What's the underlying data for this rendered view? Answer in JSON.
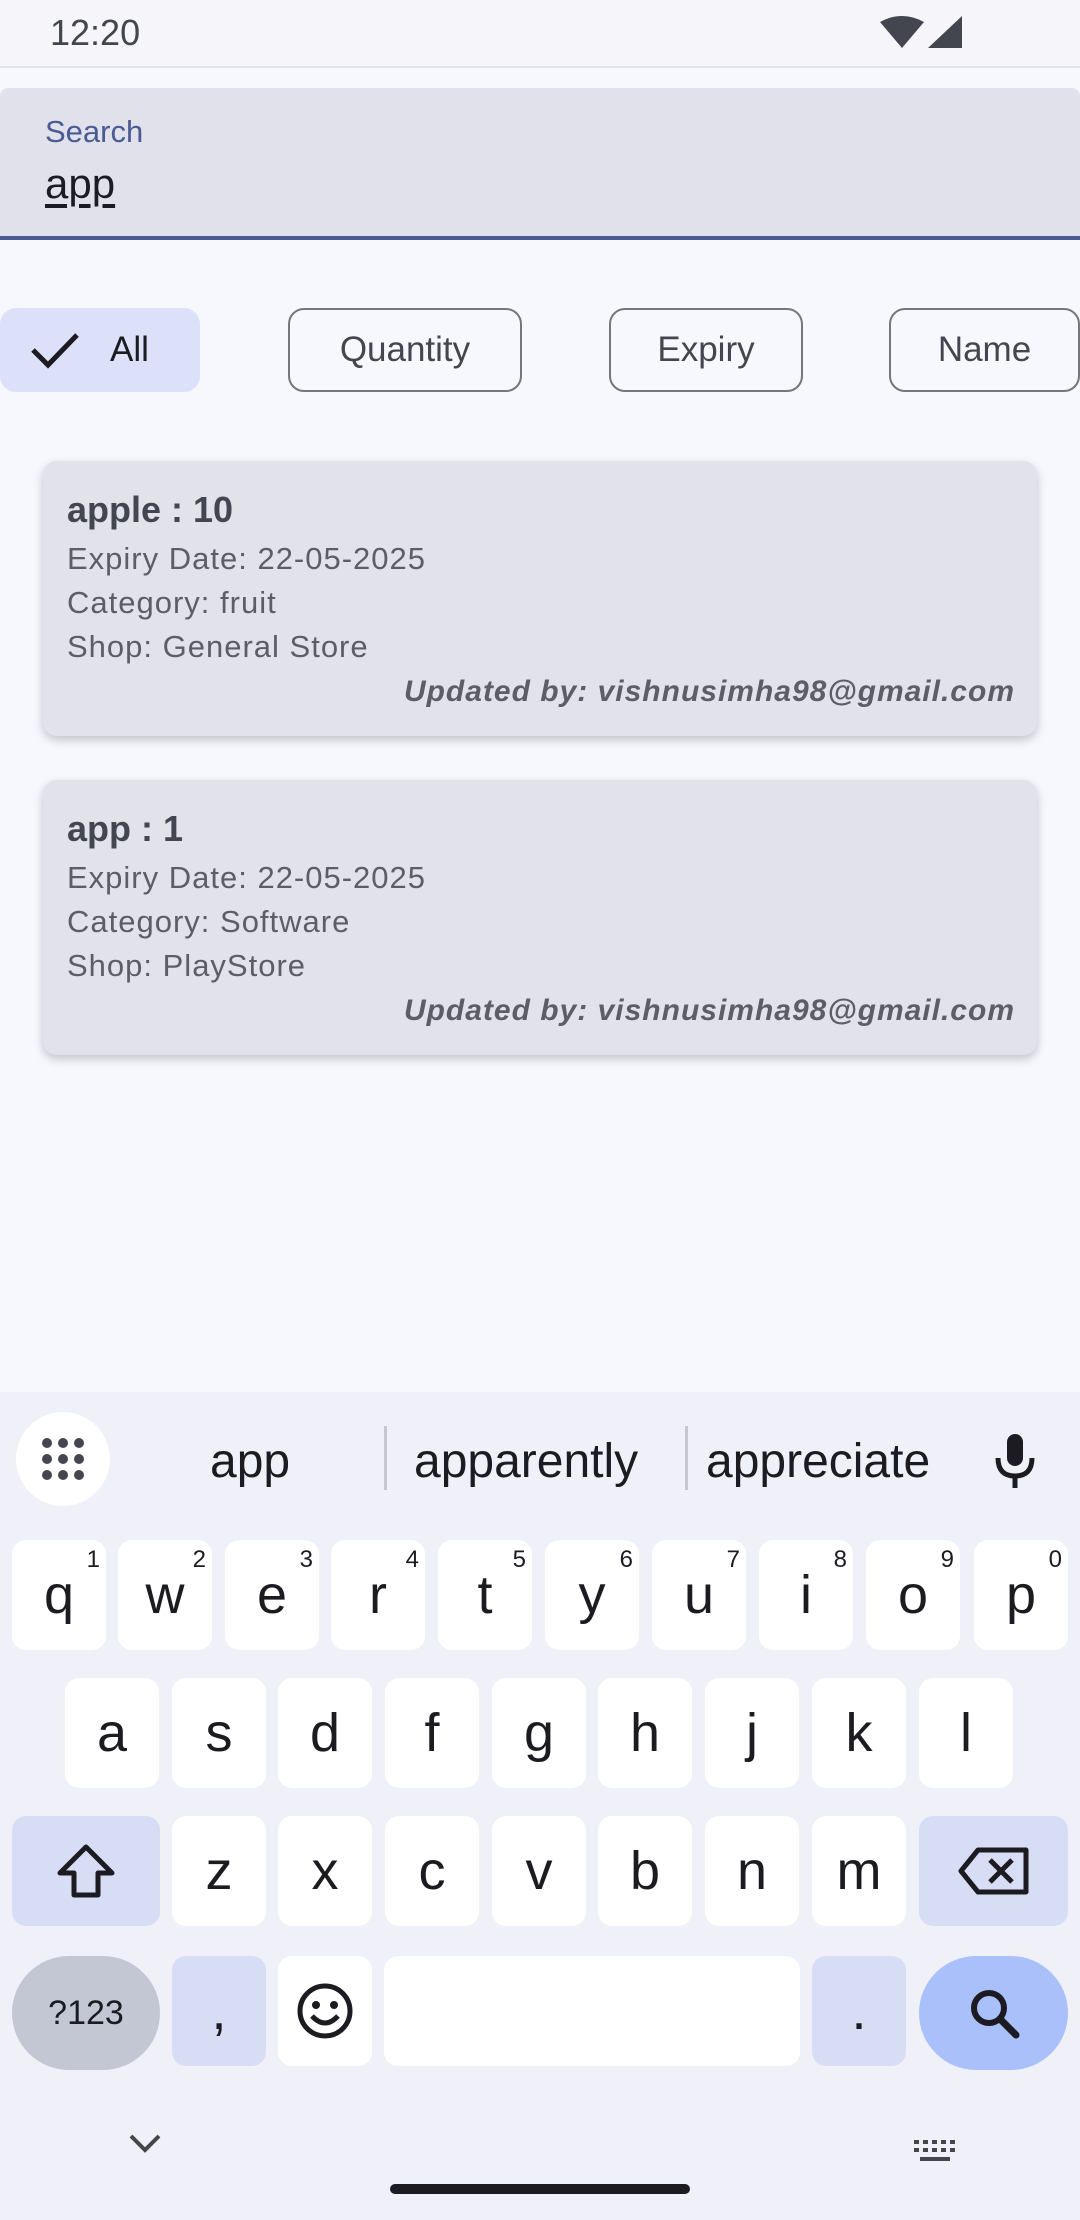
{
  "status_bar": {
    "time": "12:20"
  },
  "search": {
    "label": "Search",
    "value": "app"
  },
  "filters": [
    {
      "label": "All",
      "selected": true
    },
    {
      "label": "Quantity",
      "selected": false
    },
    {
      "label": "Expiry",
      "selected": false
    },
    {
      "label": "Name",
      "selected": false
    }
  ],
  "items": [
    {
      "title": "apple : 10",
      "expiry": "Expiry Date: 22-05-2025",
      "category": "Category: fruit",
      "shop": "Shop: General Store",
      "updated_by": "Updated by: vishnusimha98@gmail.com"
    },
    {
      "title": "app : 1",
      "expiry": "Expiry Date: 22-05-2025",
      "category": "Category: Software",
      "shop": "Shop: PlayStore",
      "updated_by": "Updated by: vishnusimha98@gmail.com"
    }
  ],
  "keyboard": {
    "suggestions": [
      "app",
      "apparently",
      "appreciate"
    ],
    "row1": [
      {
        "k": "q",
        "n": "1"
      },
      {
        "k": "w",
        "n": "2"
      },
      {
        "k": "e",
        "n": "3"
      },
      {
        "k": "r",
        "n": "4"
      },
      {
        "k": "t",
        "n": "5"
      },
      {
        "k": "y",
        "n": "6"
      },
      {
        "k": "u",
        "n": "7"
      },
      {
        "k": "i",
        "n": "8"
      },
      {
        "k": "o",
        "n": "9"
      },
      {
        "k": "p",
        "n": "0"
      }
    ],
    "row2": [
      "a",
      "s",
      "d",
      "f",
      "g",
      "h",
      "j",
      "k",
      "l"
    ],
    "row3": [
      "z",
      "x",
      "c",
      "v",
      "b",
      "n",
      "m"
    ],
    "symbols": "?123",
    "comma": ",",
    "period": "."
  },
  "icons": {
    "check": "check-icon",
    "wifi": "wifi-icon",
    "signal": "signal-icon",
    "mic": "mic-icon",
    "grid": "apps-grid-icon",
    "shift": "shift-icon",
    "backspace": "backspace-icon",
    "emoji": "emoji-icon",
    "search": "search-icon",
    "hide": "chevron-down-icon",
    "switch": "keyboard-icon"
  },
  "colors": {
    "accent": "#4a5a92",
    "chip_selected": "#dce1f9",
    "card": "#e2e2eb",
    "search_key": "#a9c0fb"
  }
}
